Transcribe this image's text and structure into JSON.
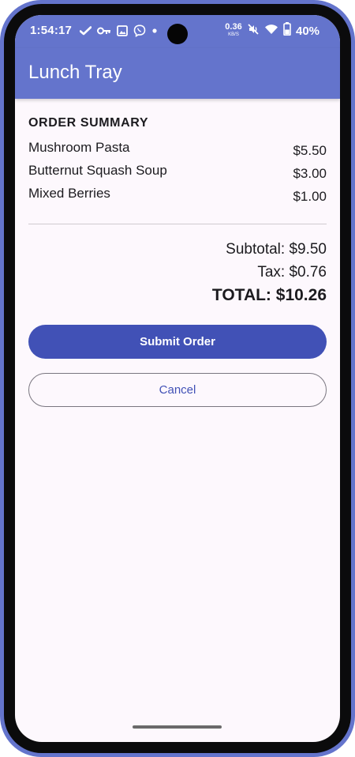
{
  "status_bar": {
    "time": "1:54:17",
    "network_speed_value": "0.36",
    "network_speed_unit": "KB/S",
    "battery_percent": "40%",
    "icons_left": [
      "check-icon",
      "key-icon",
      "image-icon",
      "viber-icon",
      "dot-icon"
    ],
    "icons_right": [
      "mute-icon",
      "wifi-icon",
      "battery-icon"
    ]
  },
  "app_bar": {
    "title": "Lunch Tray"
  },
  "order_summary": {
    "heading": "ORDER SUMMARY",
    "items": [
      {
        "name": "Mushroom Pasta",
        "price": "$5.50"
      },
      {
        "name": "Butternut Squash Soup",
        "price": "$3.00"
      },
      {
        "name": "Mixed Berries",
        "price": "$1.00"
      }
    ],
    "subtotal": "Subtotal: $9.50",
    "tax": "Tax: $0.76",
    "total": "TOTAL: $10.26"
  },
  "actions": {
    "submit_label": "Submit Order",
    "cancel_label": "Cancel"
  },
  "colors": {
    "primary": "#6474cc",
    "button_primary": "#4151b6",
    "background": "#fdf8fd",
    "text": "#1c1b1f"
  }
}
